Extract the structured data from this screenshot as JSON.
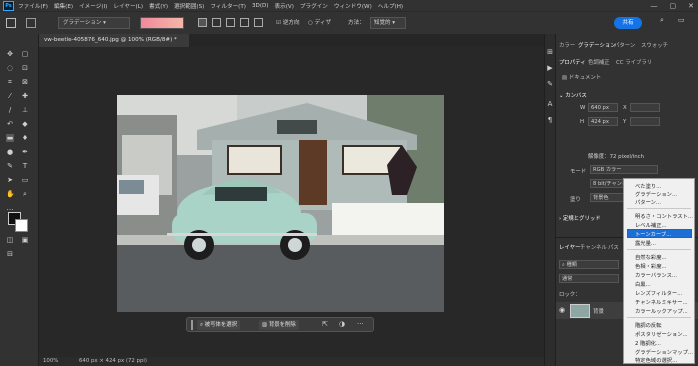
{
  "menubar": {
    "logo": "Ps",
    "items": [
      "ファイル(F)",
      "編集(E)",
      "イメージ(I)",
      "レイヤー(L)",
      "書式(Y)",
      "選択範囲(S)",
      "フィルター(T)",
      "3D(D)",
      "表示(V)",
      "プラグイン",
      "ウィンドウ(W)",
      "ヘルプ(H)"
    ],
    "window_controls": [
      "—",
      "▢",
      "✕"
    ]
  },
  "options": {
    "preset_label": "グラデーション",
    "reverse_label": "逆方向",
    "dither_label": "ディザ",
    "method_label": "方法：",
    "method_value": "知覚的",
    "share_label": "共有"
  },
  "document": {
    "tab_title": "vw-beetle-405876_640.jpg @ 100% (RGB/8#) *",
    "tab_close": "×",
    "zoom": "100%",
    "size_info": "640 px × 424 px (72 ppi)"
  },
  "context_bar": {
    "select_subject": "被写体を選択",
    "remove_bg": "背景を削除",
    "more": "···"
  },
  "panel": {
    "top_tabs": [
      "カラー",
      "グラデーション",
      "パターン",
      "スウォッチ"
    ],
    "prop_tabs": [
      "プロパティ",
      "色調補正",
      "CC ライブラリ"
    ],
    "doc_label": "ドキュメント",
    "canvas_header": "カンバス",
    "w_label": "W",
    "w_value": "640 px",
    "x_label": "X",
    "h_label": "H",
    "h_value": "424 px",
    "y_label": "Y",
    "resolution": "解像度：72 pixel/inch",
    "mode_label": "モード",
    "mode_value": "RGB カラー",
    "bit_value": "8 bit/チャンネル",
    "fill_label": "塗り",
    "fill_value": "背景色",
    "guide_header": "定規とグリッド",
    "layer_tabs": [
      "レイヤー",
      "チャンネル",
      "パス"
    ],
    "search_label": "種類",
    "blend_label": "通常",
    "lock_label": "ロック：",
    "layer_name": "背景"
  },
  "adjust_menu": {
    "items": [
      "べた塗り...",
      "グラデーション...",
      "パターン...",
      "明るさ・コントラスト...",
      "レベル補正...",
      "トーンカーブ...",
      "露光量...",
      "自然な彩度...",
      "色相・彩度...",
      "カラーバランス...",
      "白黒...",
      "レンズフィルター...",
      "チャンネルミキサー...",
      "カラールックアップ...",
      "階調の反転",
      "ポスタリゼーション...",
      "2 階調化...",
      "グラデーションマップ...",
      "特定色域の選択..."
    ],
    "highlighted": "トーンカーブ..."
  },
  "colors": {
    "accent": "#1473e6",
    "highlight_border": "#e02020",
    "car": "#a9d3c6"
  }
}
